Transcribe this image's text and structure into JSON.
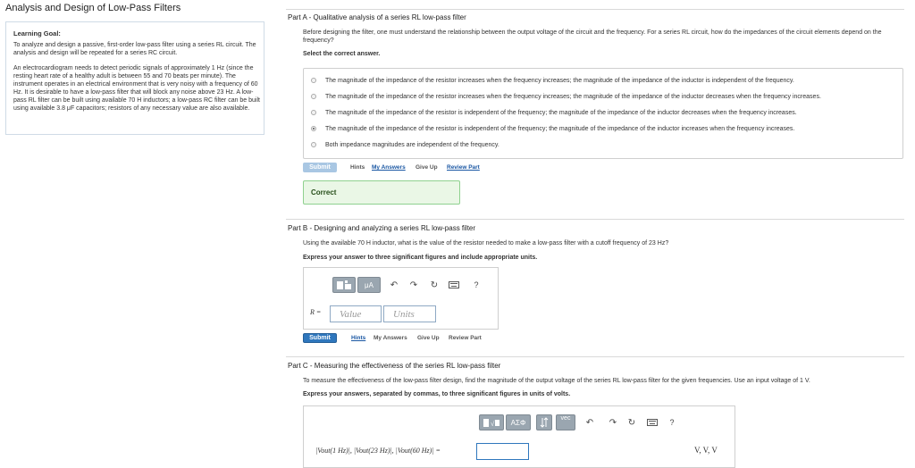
{
  "page_title": "Analysis and Design of Low-Pass Filters",
  "goal": {
    "title": "Learning Goal:",
    "p1": "To analyze and design a passive, first-order low-pass filter using a series RL circuit. The analysis and design will be repeated for a series RC circuit.",
    "p2": "An electrocardiogram needs to detect periodic signals of approximately 1 Hz (since the resting heart rate of a healthy adult is between 55 and 70 beats per minute). The instrument operates in an electrical environment that is very noisy with a frequency of 60 Hz. It is desirable to have a low-pass filter that will block any noise above 23 Hz. A low-pass RL filter can be built using available 70 H inductors; a low-pass RC filter can be built using available 3.8 μF capacitors; resistors of any necessary value are also available."
  },
  "partA": {
    "header": "Part A - Qualitative analysis of a series RL low-pass filter",
    "question": "Before designing the filter, one must understand the relationship between the output voltage of the circuit and the frequency. For a series RL circuit, how do the impedances of the circuit elements depend on the frequency?",
    "instruction": "Select the correct answer.",
    "choices": [
      "The magnitude of the impedance of the resistor increases when the frequency increases; the magnitude of the impedance of the inductor is independent of the frequency.",
      "The magnitude of the impedance of the resistor increases when the frequency increases; the magnitude of the impedance of the inductor decreases when the frequency increases.",
      "The magnitude of the impedance of the resistor is independent of the frequency; the magnitude of the impedance of the inductor decreases when the frequency increases.",
      "The magnitude of the impedance of the resistor is independent of the frequency; the magnitude of the impedance of the inductor increases when the frequency increases.",
      "Both impedance magnitudes are independent of the frequency."
    ],
    "selected_index": 3,
    "submit": "Submit",
    "hints": "Hints",
    "my_answers": "My Answers",
    "give_up": "Give Up",
    "review": "Review Part",
    "feedback": "Correct"
  },
  "partB": {
    "header": "Part B - Designing and analyzing a series RL low-pass filter",
    "question": "Using the available 70 H inductor, what is the value of the resistor needed to make a low-pass filter with a cutoff frequency of 23 Hz?",
    "instruction": "Express your answer to three significant figures and include appropriate units.",
    "toolbar_mu": "μA",
    "help": "?",
    "var_label": "R =",
    "value_placeholder": "Value",
    "units_placeholder": "Units",
    "submit": "Submit",
    "hints": "Hints",
    "my_answers": "My Answers",
    "give_up": "Give Up",
    "review": "Review Part"
  },
  "partC": {
    "header": "Part C - Measuring the effectiveness of the series RL low-pass filter",
    "question": "To measure the effectiveness of the low-pass filter design, find the magnitude of the output voltage of the series RL low-pass filter for the given frequencies. Use an input voltage of 1 V.",
    "instruction": "Express your answers, separated by commas, to three significant figures in units of volts.",
    "toolbar_greek": "ΑΣΦ",
    "toolbar_vec": "vec",
    "help": "?",
    "equation_label": "|Vout(1 Hz)|, |Vout(23 Hz)|, |Vout(60 Hz)| =",
    "units_suffix": "V, V, V"
  }
}
